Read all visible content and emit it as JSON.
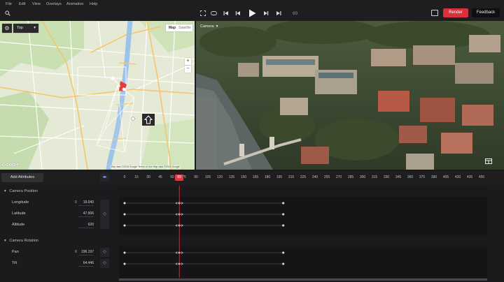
{
  "menu": [
    "File",
    "Edit",
    "View",
    "Overlays",
    "Animation",
    "Help"
  ],
  "toolbar": {
    "frame": "69",
    "render_label": "Render",
    "feedback_label": "Feedback"
  },
  "map": {
    "view_label": "Top",
    "type_map": "Map",
    "type_satellite": "Satellite",
    "google_logo": "Google",
    "attribution": "Map data ©2018 Google   Terms of Use   Map data ©2018 Google"
  },
  "camera": {
    "view_label": "Camera"
  },
  "timeline": {
    "add_attributes_label": "Add Attributes",
    "ticks": [
      "0",
      "15",
      "30",
      "45",
      "60",
      "75",
      "90",
      "105",
      "120",
      "135",
      "150",
      "165",
      "180",
      "195",
      "210",
      "225",
      "240",
      "255",
      "270",
      "285",
      "300",
      "315",
      "330",
      "345",
      "360",
      "375",
      "390",
      "405",
      "420",
      "435",
      "450"
    ],
    "current_frame": "69",
    "max_frame": 450,
    "groups": [
      {
        "name": "Camera Position",
        "attributes": [
          {
            "label": "Longitude",
            "zero": "0",
            "value": "19.040",
            "keyframes": [
              0,
              69,
              200
            ]
          },
          {
            "label": "Latitude",
            "zero": "",
            "value": "47.506",
            "keyframes": [
              0,
              69,
              200
            ]
          },
          {
            "label": "Altitude",
            "zero": "",
            "value": "620",
            "keyframes": [
              0,
              69,
              200
            ]
          }
        ]
      },
      {
        "name": "Camera Rotation",
        "attributes": [
          {
            "label": "Pan",
            "zero": "0",
            "value": "196.197",
            "keyframes": [
              0,
              69,
              200
            ]
          },
          {
            "label": "Tilt",
            "zero": "",
            "value": "64.446",
            "keyframes": [
              0,
              69,
              200
            ]
          }
        ]
      }
    ]
  },
  "colors": {
    "accent_red": "#d8303c",
    "playhead": "#e03a45",
    "key_blue": "#6aa1ff"
  },
  "icons": [
    "search-icon",
    "fullscreen-icon",
    "loop-icon",
    "skip-back-icon",
    "step-back-icon",
    "play-icon",
    "step-forward-icon",
    "skip-forward-icon",
    "image-icon",
    "gear-icon",
    "zoom-in-icon",
    "zoom-out-icon",
    "expand-icon",
    "keyframe-nav-icon"
  ]
}
